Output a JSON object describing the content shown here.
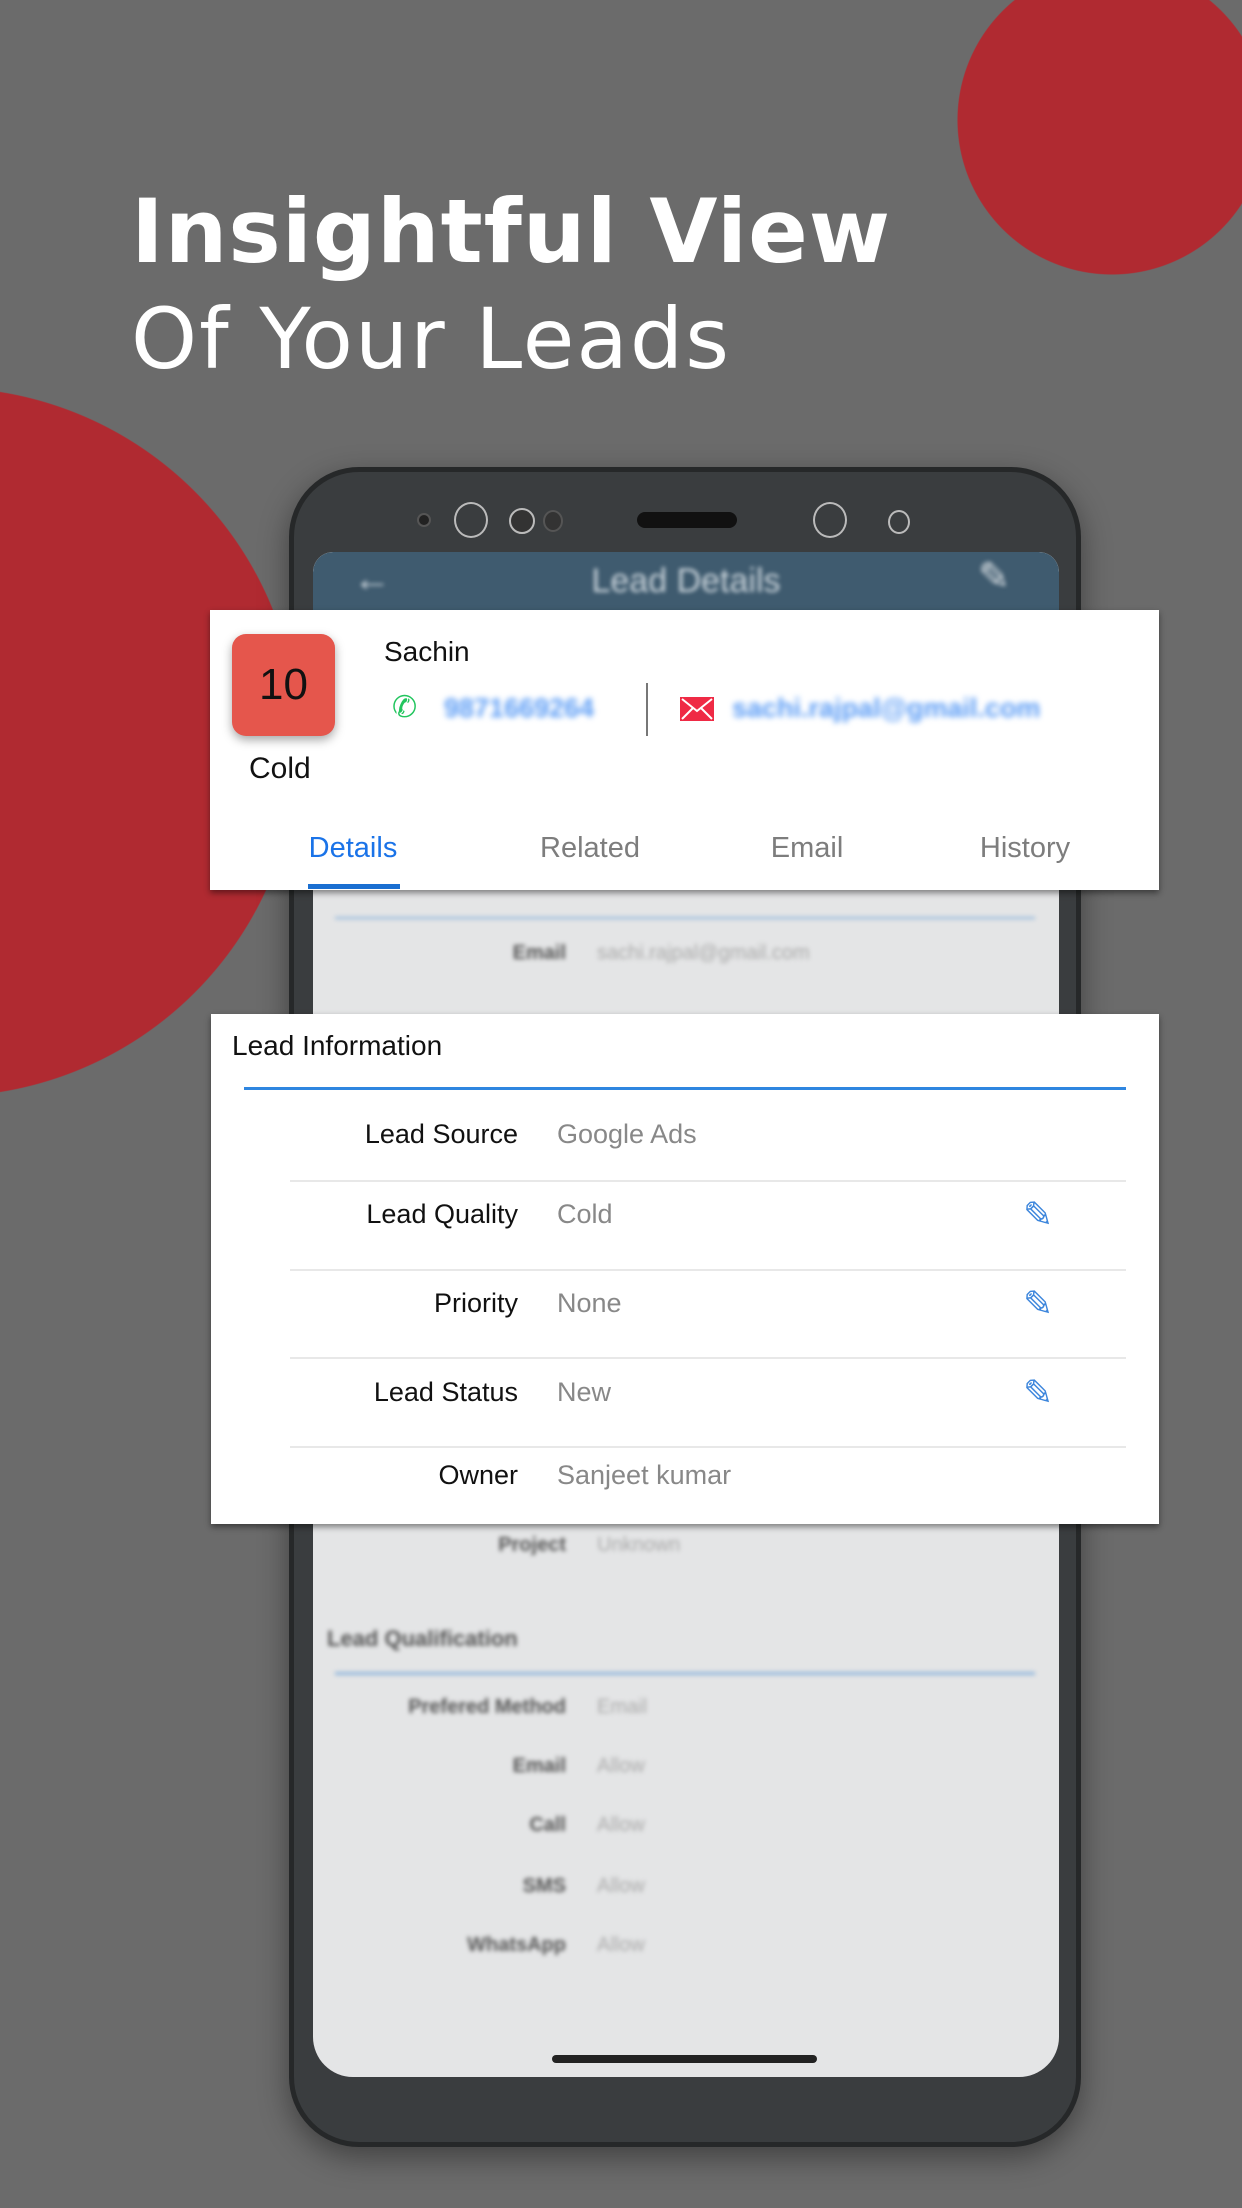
{
  "headline": {
    "line1": "Insightful View",
    "line2": "Of Your Leads"
  },
  "colors": {
    "accent_red": "#b02a31",
    "background": "#6b6b6b",
    "badge": "#e5564c",
    "link_blue": "#1a73e8"
  },
  "appbar": {
    "title": "Lead Details",
    "back_icon": "arrow-left-icon",
    "edit_icon": "pencil-icon"
  },
  "lead": {
    "score": "10",
    "quality": "Cold",
    "name": "Sachin",
    "phone": "9871669264",
    "email": "sachi.rajpal@gmail.com"
  },
  "tabs": [
    {
      "label": "Details",
      "active": true
    },
    {
      "label": "Related"
    },
    {
      "label": "Email"
    },
    {
      "label": "History"
    }
  ],
  "behind_top": {
    "label": "Email",
    "value": "sachi.rajpal@gmail.com"
  },
  "lead_information": {
    "title": "Lead Information",
    "rows": [
      {
        "label": "Lead Source",
        "value": "Google Ads",
        "editable": false
      },
      {
        "label": "Lead Quality",
        "value": "Cold",
        "editable": true
      },
      {
        "label": "Priority",
        "value": "None",
        "editable": true
      },
      {
        "label": "Lead Status",
        "value": "New",
        "editable": true
      },
      {
        "label": "Owner",
        "value": "Sanjeet kumar",
        "editable": false
      }
    ]
  },
  "behind_bottom": {
    "project": {
      "label": "Project",
      "value": "Unknown"
    },
    "qualification_title": "Lead Qualification",
    "rows": [
      {
        "label": "Prefered Method",
        "value": "Email"
      },
      {
        "label": "Email",
        "value": "Allow"
      },
      {
        "label": "Call",
        "value": "Allow"
      },
      {
        "label": "SMS",
        "value": "Allow"
      },
      {
        "label": "WhatsApp",
        "value": "Allow"
      }
    ]
  }
}
